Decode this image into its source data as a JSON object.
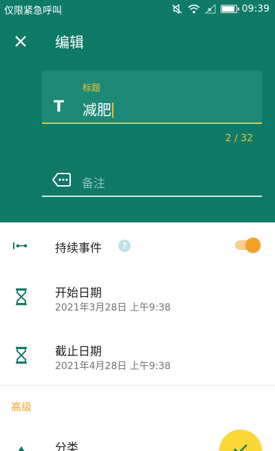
{
  "status_bar": {
    "carrier_text": "仅限紧急呼叫",
    "time": "09:39"
  },
  "toolbar": {
    "title": "编辑",
    "close_icon": "close-icon"
  },
  "title_field": {
    "label": "标题",
    "value": "减肥",
    "counter": "2 / 32",
    "icon": "text-format-icon"
  },
  "note_field": {
    "placeholder": "备注",
    "icon": "label-tag-icon"
  },
  "duration_row": {
    "label": "持续事件",
    "help": "?",
    "toggle_on": true
  },
  "start_row": {
    "label": "开始日期",
    "value": "2021年3月28日 上午9:38"
  },
  "end_row": {
    "label": "截止日期",
    "value": "2021年4月28日 上午9:38"
  },
  "advanced": {
    "section_label": "高级",
    "category_label": "分类"
  },
  "colors": {
    "header": "#0f7a68",
    "accent_yellow": "#f2c230",
    "accent_orange": "#f2a224",
    "fab": "#fbd735"
  }
}
